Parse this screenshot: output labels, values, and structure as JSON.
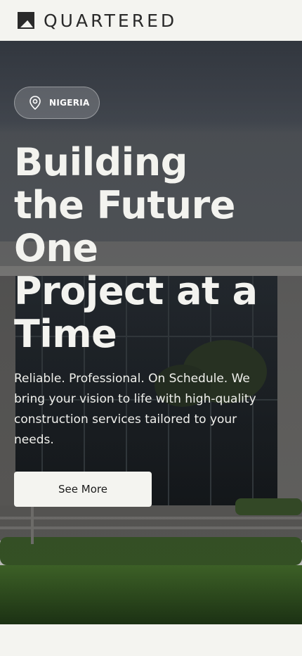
{
  "brand": {
    "name": "QUARTERED",
    "logo_icon": "quartered-logo-icon"
  },
  "hero": {
    "location_icon": "map-pin-icon",
    "location": "NIGERIA",
    "headline_lines": [
      "Building",
      "the Future",
      "One",
      "Project at a",
      "Time"
    ],
    "subtext_lines": [
      "Reliable. Professional. On Schedule. We",
      "bring your vision to life with high-quality",
      "construction services tailored to your",
      "needs."
    ],
    "cta_label": "See More"
  },
  "colors": {
    "page_bg": "#f4f4f0",
    "text_light": "#f3f3ef",
    "logo_dark": "#2a2a2a"
  }
}
